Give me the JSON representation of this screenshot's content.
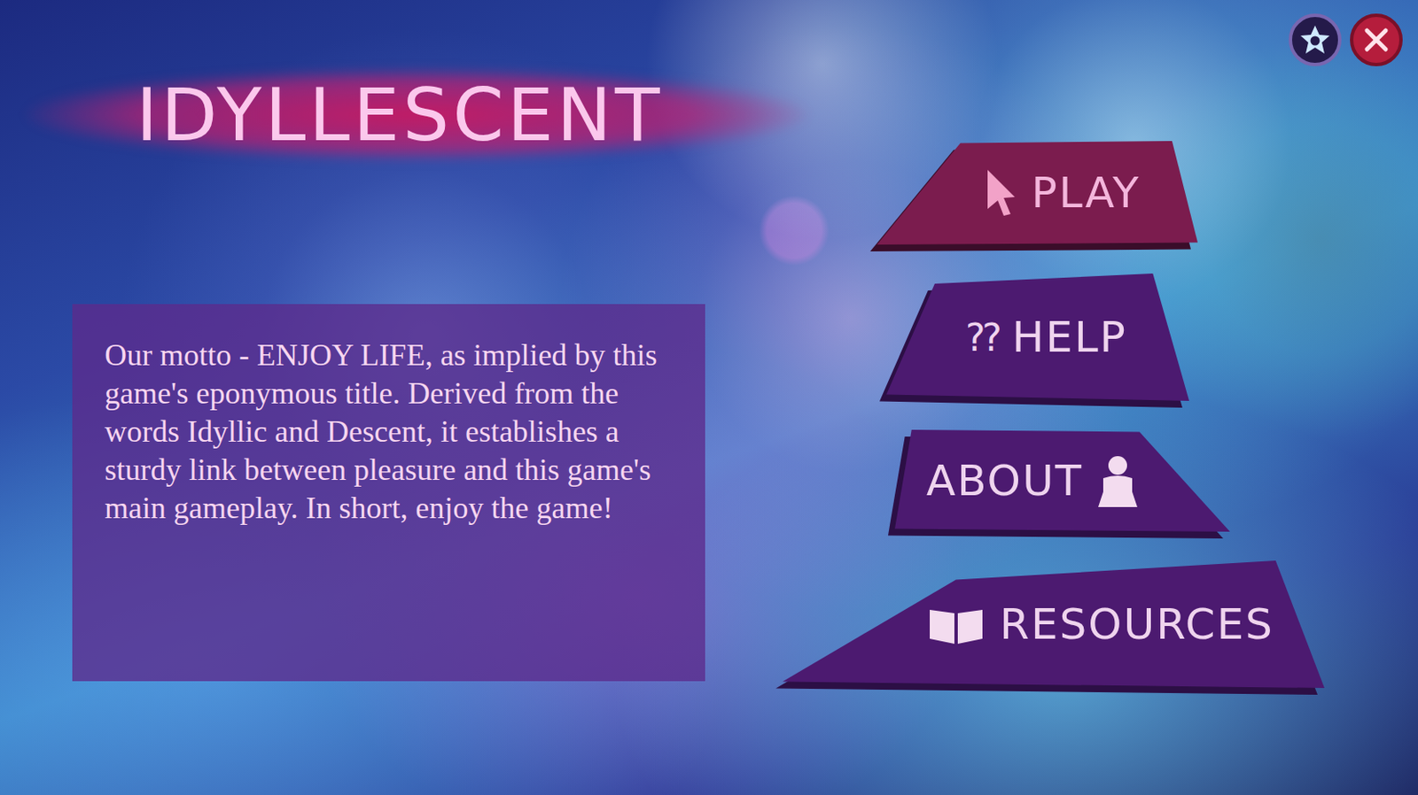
{
  "game": {
    "title": "IDYLLESCENT"
  },
  "description": "Our motto - ENJOY LIFE, as implied by this game's eponymous title. Derived from the words Idyllic and Descent, it establishes a sturdy link between pleasure and this game's main gameplay. In short, enjoy the game!",
  "menu": [
    {
      "label": "PLAY",
      "selected": true
    },
    {
      "label": "HELP",
      "glyph": "??",
      "selected": false
    },
    {
      "label": "ABOUT",
      "selected": false
    },
    {
      "label": "RESOURCES",
      "selected": false
    }
  ]
}
